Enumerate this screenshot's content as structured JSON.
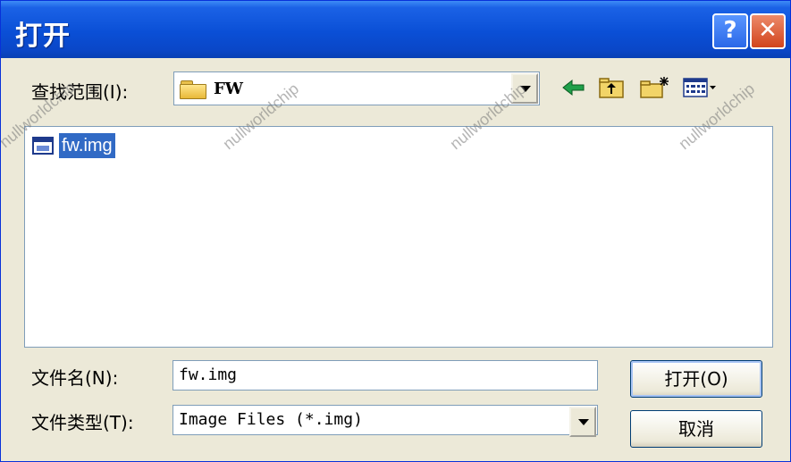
{
  "window": {
    "title": "打开",
    "help_label": "?",
    "close_label": "✕"
  },
  "lookin": {
    "label": "查找范围(I):",
    "value": "FW"
  },
  "toolbar": {
    "back_icon": "back-arrow-icon",
    "up_icon": "up-folder-icon",
    "new_folder_icon": "new-folder-icon",
    "view_icon": "view-menu-icon"
  },
  "files": [
    {
      "name": "fw.img",
      "icon": "disk-image-icon",
      "selected": true
    }
  ],
  "filename": {
    "label": "文件名(N):",
    "value": "fw.img"
  },
  "filetype": {
    "label": "文件类型(T):",
    "value": "Image Files (*.img)"
  },
  "buttons": {
    "open": "打开(O)",
    "cancel": "取消"
  },
  "watermark": "nullworldchip",
  "colors": {
    "titlebar": "#0a4fd6",
    "selection": "#316ac5",
    "dialog_bg": "#ece9d8"
  }
}
